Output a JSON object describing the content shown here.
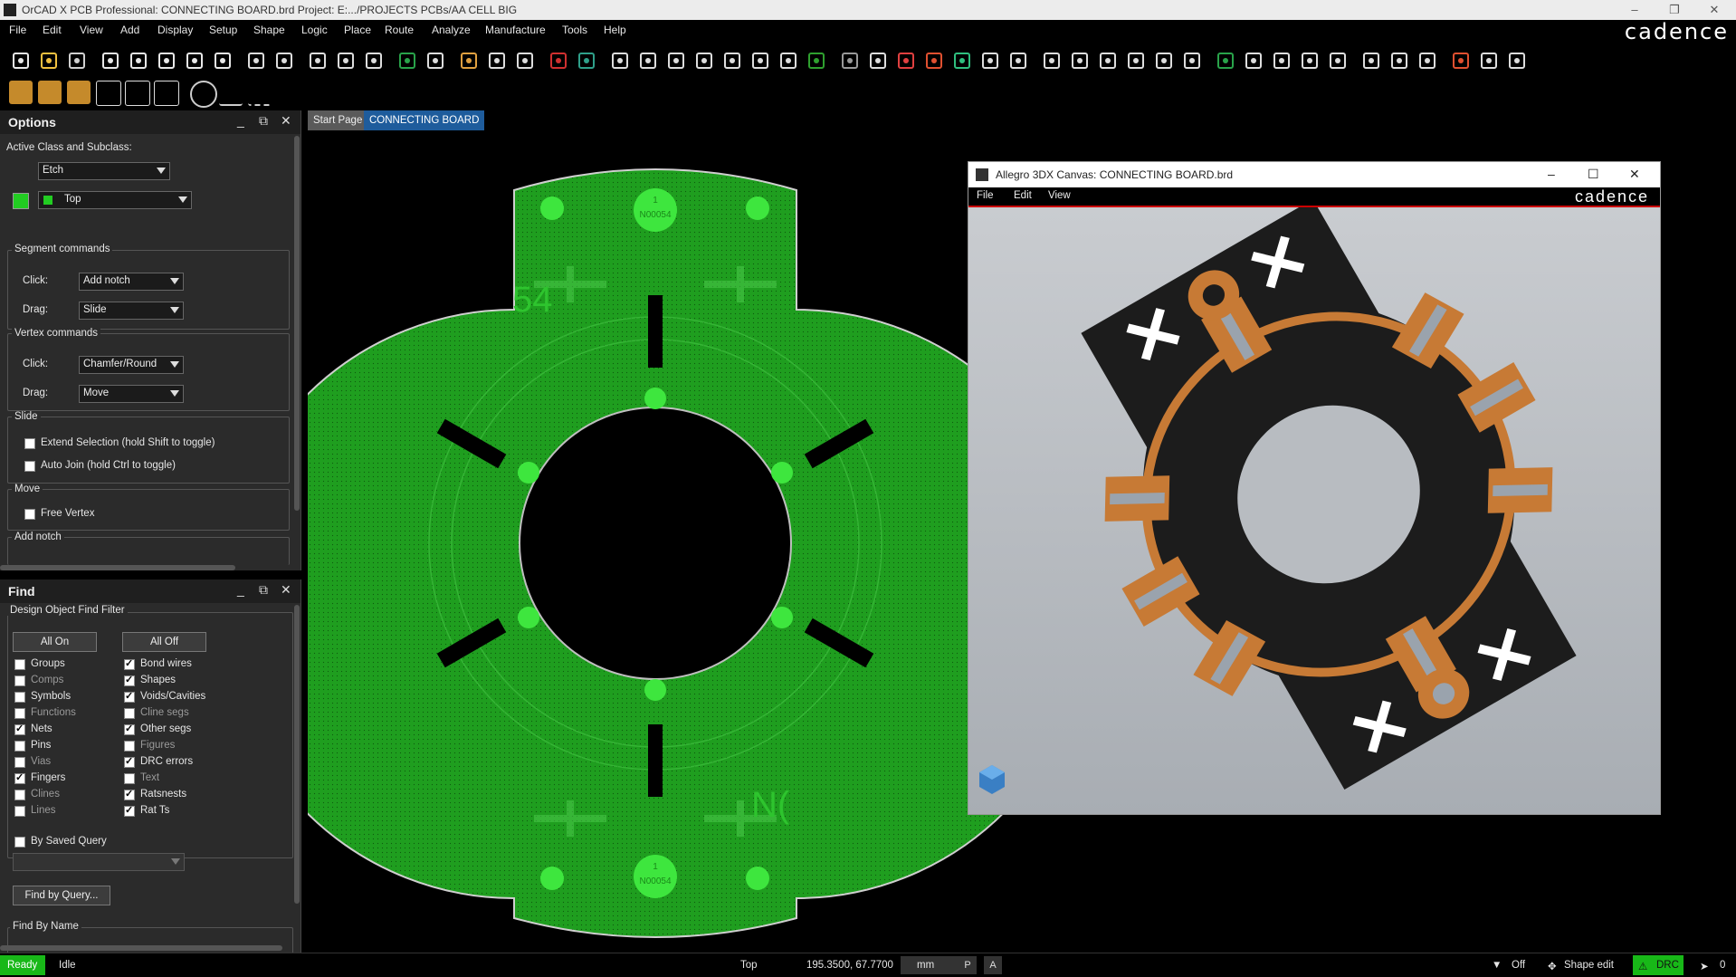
{
  "title_bar": {
    "text": "OrCAD X PCB Professional: CONNECTING BOARD.brd  Project: E:.../PROJECTS PCBs/AA CELL BIG",
    "minimize": "–",
    "restore": "❐",
    "close": "✕"
  },
  "menu": [
    "File",
    "Edit",
    "View",
    "Add",
    "Display",
    "Setup",
    "Shape",
    "Logic",
    "Place",
    "Route",
    "Analyze",
    "Manufacture",
    "Tools",
    "Help"
  ],
  "brand": "cadence",
  "options": {
    "title": "Options",
    "active_class_label": "Active Class and Subclass:",
    "class_value": "Etch",
    "subclass_value": "Top",
    "subclass_color": "#22cc22",
    "segment_group": "Segment commands",
    "seg_click_label": "Click:",
    "seg_click_value": "Add notch",
    "seg_drag_label": "Drag:",
    "seg_drag_value": "Slide",
    "vertex_group": "Vertex commands",
    "vtx_click_label": "Click:",
    "vtx_click_value": "Chamfer/Round",
    "vtx_drag_label": "Drag:",
    "vtx_drag_value": "Move",
    "slide_group": "Slide",
    "extend_selection": "Extend Selection (hold Shift to toggle)",
    "auto_join": "Auto Join (hold Ctrl to toggle)",
    "move_group": "Move",
    "free_vertex": "Free Vertex",
    "add_notch_group": "Add notch"
  },
  "find": {
    "title": "Find",
    "filter_group": "Design Object Find Filter",
    "all_on": "All On",
    "all_off": "All Off",
    "left_items": [
      {
        "label": "Groups",
        "checked": false,
        "dim": false
      },
      {
        "label": "Comps",
        "checked": false,
        "dim": true
      },
      {
        "label": "Symbols",
        "checked": false,
        "dim": false
      },
      {
        "label": "Functions",
        "checked": false,
        "dim": true
      },
      {
        "label": "Nets",
        "checked": true,
        "dim": false
      },
      {
        "label": "Pins",
        "checked": false,
        "dim": false
      },
      {
        "label": "Vias",
        "checked": false,
        "dim": true
      },
      {
        "label": "Fingers",
        "checked": true,
        "dim": false
      },
      {
        "label": "Clines",
        "checked": false,
        "dim": true
      },
      {
        "label": "Lines",
        "checked": false,
        "dim": true
      }
    ],
    "right_items": [
      {
        "label": "Bond wires",
        "checked": true,
        "dim": false
      },
      {
        "label": "Shapes",
        "checked": true,
        "dim": false
      },
      {
        "label": "Voids/Cavities",
        "checked": true,
        "dim": false
      },
      {
        "label": "Cline segs",
        "checked": false,
        "dim": true
      },
      {
        "label": "Other segs",
        "checked": true,
        "dim": false
      },
      {
        "label": "Figures",
        "checked": false,
        "dim": true
      },
      {
        "label": "DRC errors",
        "checked": true,
        "dim": false
      },
      {
        "label": "Text",
        "checked": false,
        "dim": true
      },
      {
        "label": "Ratsnests",
        "checked": true,
        "dim": false
      },
      {
        "label": "Rat Ts",
        "checked": true,
        "dim": false
      }
    ],
    "by_saved_query": "By Saved Query",
    "find_by_query": "Find by Query...",
    "find_by_name": "Find By Name"
  },
  "tabs": [
    {
      "label": "Start Page",
      "active": false
    },
    {
      "label": "CONNECTING BOARD",
      "active": true
    }
  ],
  "board": {
    "copper_color": "#1f9e1f",
    "pad_color": "#3ee63e",
    "pad_label_num": "1",
    "pad_label_net": "N00054",
    "edge_text_left": "54",
    "edge_text_right": "N("
  },
  "win3d": {
    "title": "Allegro 3DX Canvas: CONNECTING BOARD.brd",
    "menu": [
      "File",
      "Edit",
      "View"
    ],
    "brand": "cadence",
    "board_color": "#1c1c1c",
    "copper_color": "#c77a35",
    "pad_color": "#9aa3ad"
  },
  "status": {
    "ready": "Ready",
    "idle": "Idle",
    "layer": "Top",
    "coords": "195.3500, 67.7700",
    "units": "mm",
    "p": "P",
    "a": "A",
    "filter": "Off",
    "mode": "Shape edit",
    "drc": "DRC",
    "count": "0"
  },
  "toolbar_icons": [
    "new-icon",
    "open-icon",
    "save-icon",
    "move-icon",
    "copy-icon",
    "delete-icon",
    "undo-icon",
    "redo-icon",
    "pin-icon",
    "unpin-icon",
    "add-line-icon",
    "add-text-icon",
    "edit-text-icon",
    "place-icon",
    "component-icon",
    "route-icon",
    "fanout-icon",
    "slide-icon",
    "drc-icon",
    "drc-update-icon",
    "zoom-out-icon",
    "zoom-fit-icon",
    "zoom-in-icon",
    "zoom-prev-icon",
    "zoom-world-icon",
    "zoom-center-icon",
    "redraw-icon",
    "3d-icon",
    "3d-text-icon",
    "grid-icon",
    "color-icon",
    "layer-icon",
    "stackup-icon",
    "report-icon",
    "settings-icon",
    "visibility-icon",
    "info-icon",
    "measure-icon",
    "shadow-icon",
    "highlight-icon",
    "dehighlight-icon",
    "shape-add-icon",
    "shape-void-icon",
    "shape-circle-icon",
    "shape-edit-icon",
    "shape-select-icon",
    "place-manual-icon",
    "unplace-icon",
    "snapshot-icon",
    "r-icon",
    "export-icon",
    "comment-icon"
  ]
}
